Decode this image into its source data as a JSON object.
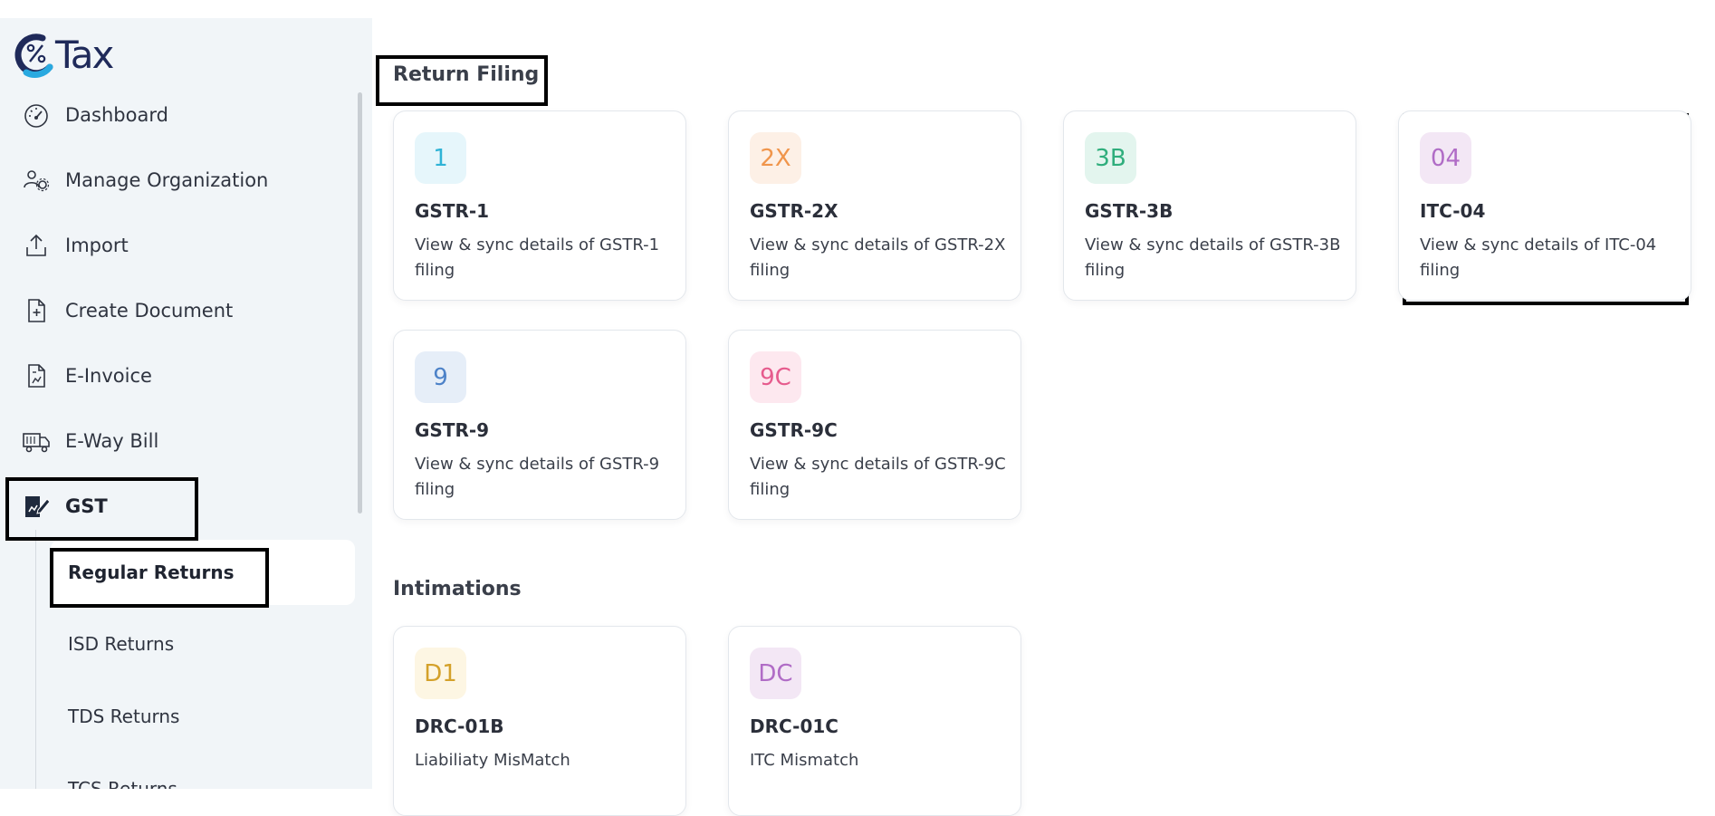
{
  "brand": {
    "logo_text": "Tax"
  },
  "sidebar": {
    "items": [
      {
        "label": "Dashboard",
        "icon": "dashboard-gauge-icon"
      },
      {
        "label": "Manage Organization",
        "icon": "users-gear-icon"
      },
      {
        "label": "Import",
        "icon": "upload-tray-icon"
      },
      {
        "label": "Create Document",
        "icon": "document-plus-icon"
      },
      {
        "label": "E-Invoice",
        "icon": "invoice-document-icon"
      },
      {
        "label": "E-Way Bill",
        "icon": "truck-icon"
      },
      {
        "label": "GST",
        "icon": "gst-document-pen-icon"
      }
    ],
    "sub_items": [
      {
        "label": "Regular Returns"
      },
      {
        "label": "ISD Returns"
      },
      {
        "label": "TDS Returns"
      },
      {
        "label": "TCS Returns"
      }
    ]
  },
  "return_filing": {
    "title": "Return Filing",
    "cards": [
      {
        "badge": "1",
        "title": "GSTR-1",
        "desc": "View & sync details of GSTR-1 filing",
        "badge_bg": "#e6f6fb",
        "badge_fg": "#2fb3d6"
      },
      {
        "badge": "2X",
        "title": "GSTR-2X",
        "desc": "View & sync details of GSTR-2X filing",
        "badge_bg": "#fdf0e6",
        "badge_fg": "#f0954b"
      },
      {
        "badge": "3B",
        "title": "GSTR-3B",
        "desc": "View & sync details of GSTR-3B filing",
        "badge_bg": "#e3f5ee",
        "badge_fg": "#2fae7c"
      },
      {
        "badge": "04",
        "title": "ITC-04",
        "desc": "View & sync details of ITC-04 filing",
        "badge_bg": "#f3e7f5",
        "badge_fg": "#b06cc6"
      },
      {
        "badge": "9",
        "title": "GSTR-9",
        "desc": "View & sync details of GSTR-9 filing",
        "badge_bg": "#e6eef8",
        "badge_fg": "#4d82c8"
      },
      {
        "badge": "9C",
        "title": "GSTR-9C",
        "desc": "View & sync details of GSTR-9C filing",
        "badge_bg": "#fde8ef",
        "badge_fg": "#e65b8d"
      }
    ]
  },
  "intimations": {
    "title": "Intimations",
    "cards": [
      {
        "badge": "D1",
        "title": "DRC-01B",
        "desc": "Liabiliaty MisMatch",
        "badge_bg": "#fdf6e3",
        "badge_fg": "#d4a12a"
      },
      {
        "badge": "DC",
        "title": "DRC-01C",
        "desc": "ITC Mismatch",
        "badge_bg": "#f3e7f5",
        "badge_fg": "#b06cc6"
      }
    ]
  }
}
